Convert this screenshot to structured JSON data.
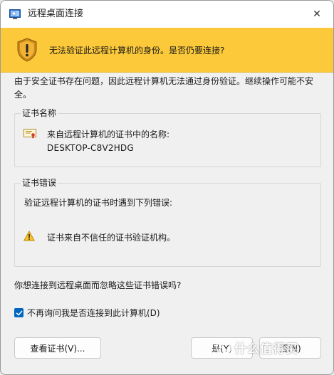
{
  "window": {
    "title": "远程桌面连接",
    "close_glyph": "✕"
  },
  "banner": {
    "message": "无法验证此远程计算机的身份。是否仍要连接?",
    "color": "#fcc93a"
  },
  "intro_text": "由于安全证书存在问题，因此远程计算机无法通过身份验证。继续操作可能不安全。",
  "cert_name_group": {
    "title": "证书名称",
    "label": "来自远程计算机的证书中的名称:",
    "value": "DESKTOP-C8V2HDG",
    "icon": "certificate-icon"
  },
  "cert_error_group": {
    "title": "证书错误",
    "intro": "验证远程计算机的证书时遇到下列错误:",
    "errors": [
      {
        "icon": "warning-icon",
        "text": "证书来自不信任的证书验证机构。"
      }
    ]
  },
  "question": "你想连接到远程桌面而忽略这些证书错误吗?",
  "dont_ask_checkbox": {
    "label": "不再询问我是否连接到此计算机(D)",
    "checked": true
  },
  "buttons": {
    "view_cert": "查看证书(V)...",
    "yes": "是(Y)",
    "no": "否(N)"
  },
  "watermark": {
    "text": "什么值得买"
  },
  "accent_color": "#0067c0"
}
